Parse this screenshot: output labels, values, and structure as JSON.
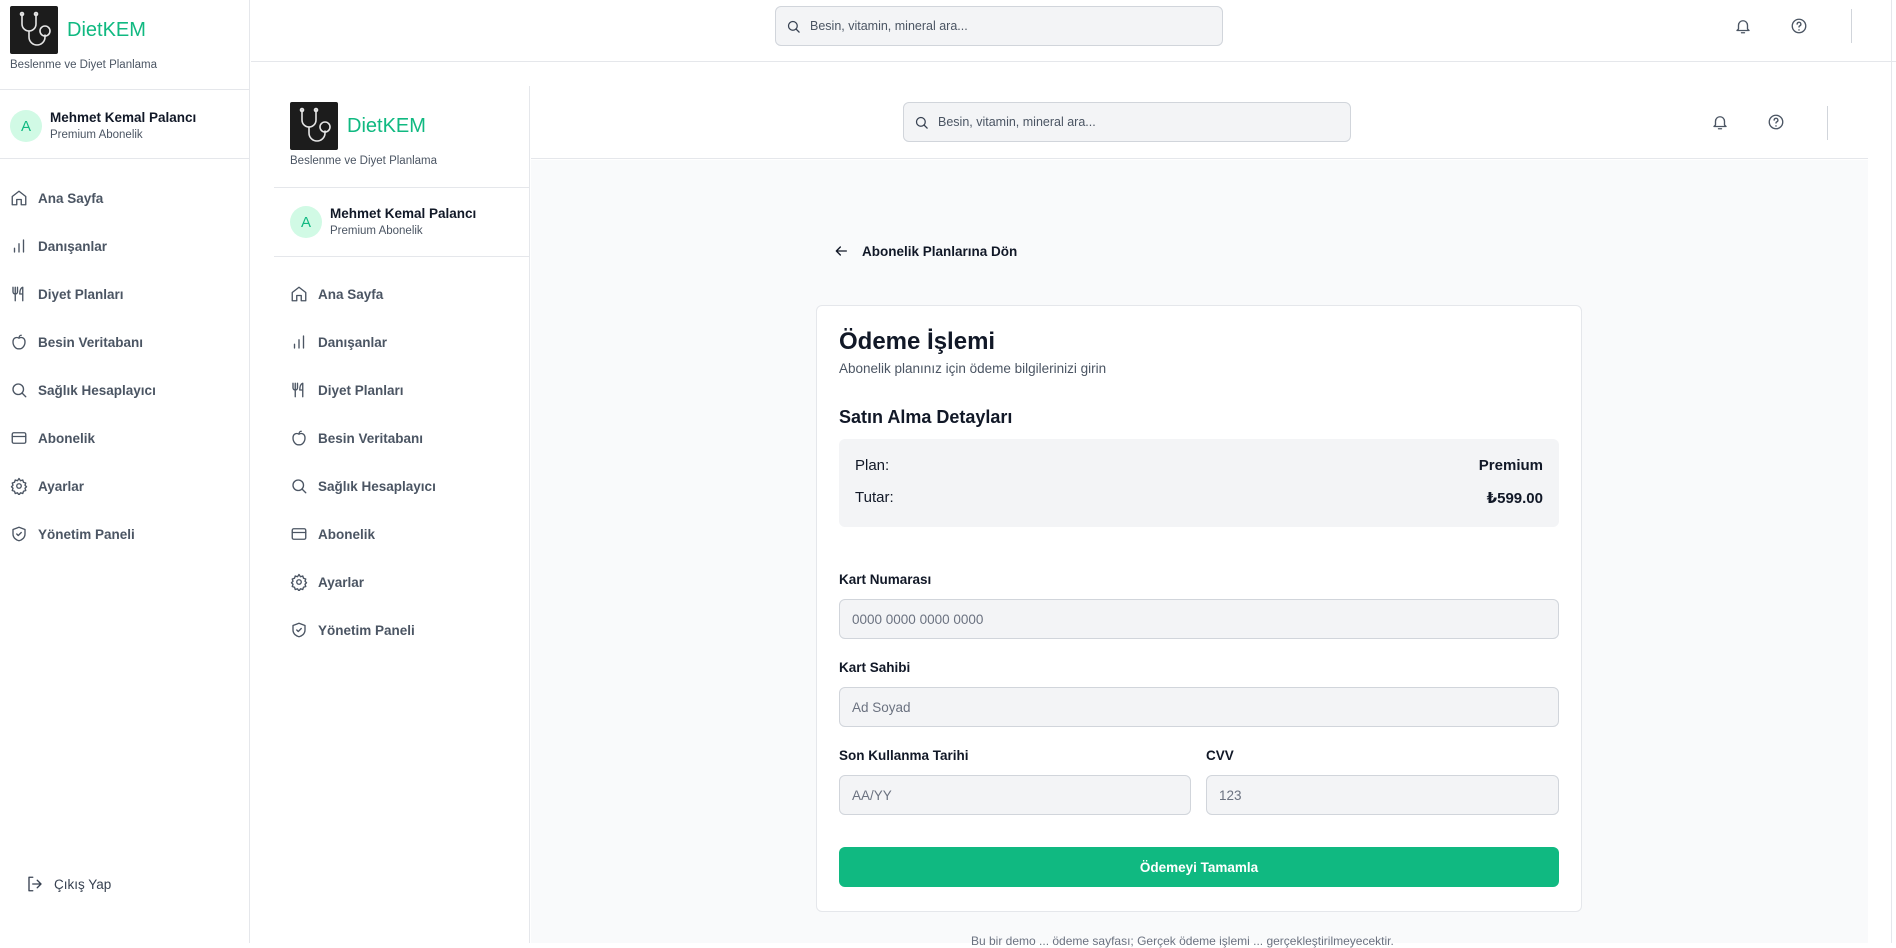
{
  "brand": {
    "name": "DietKEM",
    "subtitle": "Beslenme ve Diyet Planlama"
  },
  "user": {
    "initial": "A",
    "name": "Mehmet Kemal Palancı",
    "plan": "Premium Abonelik"
  },
  "nav": [
    {
      "label": "Ana Sayfa",
      "icon": "home-icon"
    },
    {
      "label": "Danışanlar",
      "icon": "bar-chart-icon"
    },
    {
      "label": "Diyet Planları",
      "icon": "utensils-icon"
    },
    {
      "label": "Besin Veritabanı",
      "icon": "apple-icon"
    },
    {
      "label": "Sağlık Hesaplayıcı",
      "icon": "search-icon"
    },
    {
      "label": "Abonelik",
      "icon": "credit-card-icon"
    },
    {
      "label": "Ayarlar",
      "icon": "gear-icon"
    },
    {
      "label": "Yönetim Paneli",
      "icon": "shield-check-icon"
    }
  ],
  "logout_label": "Çıkış Yap",
  "search": {
    "placeholder": "Besin, vitamin, mineral ara..."
  },
  "back_label": "Abonelik Planlarına Dön",
  "payment": {
    "title": "Ödeme İşlemi",
    "subtitle": "Abonelik planınız için ödeme bilgilerinizi girin",
    "details_title": "Satın Alma Detayları",
    "plan_label": "Plan:",
    "plan_value": "Premium",
    "amount_label": "Tutar:",
    "amount_value": "₺599.00",
    "card_number_label": "Kart Numarası",
    "card_number_placeholder": "0000 0000 0000 0000",
    "card_holder_label": "Kart Sahibi",
    "card_holder_placeholder": "Ad Soyad",
    "expiry_label": "Son Kullanma Tarihi",
    "expiry_placeholder": "AA/YY",
    "cvv_label": "CVV",
    "cvv_placeholder": "123",
    "submit_label": "Ödemeyi Tamamla"
  },
  "footer_text": "Bu bir demo ... ödeme sayfası; Gerçek ödeme işlemi ... gerçekleştirilmeyecektir."
}
